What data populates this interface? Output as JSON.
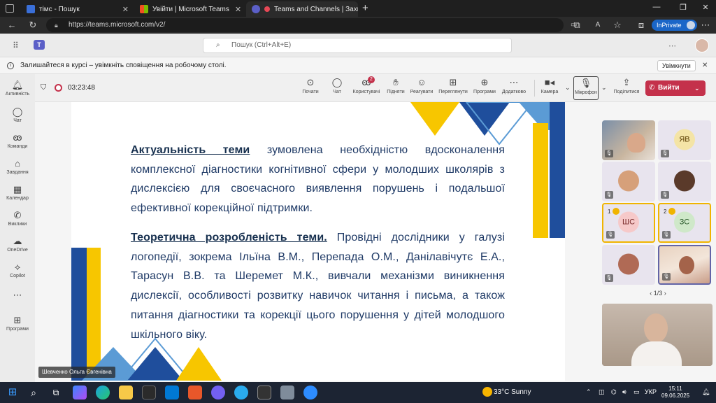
{
  "browser": {
    "tabs": [
      {
        "title": "тімс - Пошук",
        "favicon_color": "#3a6fd8"
      },
      {
        "title": "Увійти | Microsoft Teams",
        "favicon_color": "#f25022"
      },
      {
        "title": "Teams and Channels | Захис",
        "favicon_color": "#5b5fc7",
        "active": true
      }
    ],
    "new_tab_icon": "plus-icon",
    "url": "https://teams.microsoft.com/v2/",
    "inprivate_label": "InPrivate"
  },
  "teams_header": {
    "search_placeholder": "Пошук (Ctrl+Alt+E)"
  },
  "notification": {
    "text": "Залишайтеся в курсі – увімкніть сповіщення на робочому столі.",
    "button_label": "Увімкнути"
  },
  "rail": {
    "items": [
      {
        "label": "Активність",
        "icon": "bell-icon"
      },
      {
        "label": "Чат",
        "icon": "chat-icon"
      },
      {
        "label": "Команди",
        "icon": "teams-icon"
      },
      {
        "label": "Завдання",
        "icon": "tasks-icon"
      },
      {
        "label": "Календар",
        "icon": "calendar-icon"
      },
      {
        "label": "Виклики",
        "icon": "phone-icon"
      },
      {
        "label": "OneDrive",
        "icon": "cloud-icon"
      },
      {
        "label": "Copilot",
        "icon": "copilot-icon"
      },
      {
        "label": "Програми",
        "icon": "apps-icon"
      }
    ]
  },
  "meeting": {
    "timer": "03:23:48",
    "tools": [
      {
        "label": "Почати",
        "icon": "record-icon"
      },
      {
        "label": "Чат",
        "icon": "chat-icon"
      },
      {
        "label": "Користувачі",
        "icon": "people-icon",
        "badge": "2"
      },
      {
        "label": "Підняти",
        "icon": "hand-icon"
      },
      {
        "label": "Реагувати",
        "icon": "smile-icon"
      },
      {
        "label": "Переглянути",
        "icon": "view-icon"
      },
      {
        "label": "Програми",
        "icon": "apps-icon"
      },
      {
        "label": "Додатково",
        "icon": "more-icon"
      },
      {
        "label": "Камера",
        "icon": "camera-icon"
      },
      {
        "label": "Мікрофон",
        "icon": "mic-icon"
      },
      {
        "label": "Поділитися",
        "icon": "share-icon"
      }
    ],
    "leave_label": "Вийти"
  },
  "slide": {
    "para1_heading": "Актуальність теми",
    "para1_body": " зумовлена необхідністю вдосконалення комплексної діагностики когнітивної сфери у молодших школярів з дислексією для своєчасного виявлення порушень і подальшої ефективної корекційної підтримки.",
    "para2_heading": "Теоретична розробленість теми.",
    "para2_body": " Провідні дослідники у галузі логопедії, зокрема Ільїна В.М., Перепада О.М., Данілавічутє Е.А., Тарасун В.В. та Шеремет М.К., вивчали механізми виникнення дислексії, особливості розвитку навичок читання і письма, а також питання діагностики та корекції цього порушення у дітей молодшого шкільного віку.",
    "presenter_name": "Шевченко Ольга Євгенівна",
    "colors": {
      "blue": "#1f4e9c",
      "yellow": "#f7c600",
      "light_blue": "#5b9bd5"
    }
  },
  "participants": {
    "tiles": [
      {
        "initials": "",
        "kind": "video"
      },
      {
        "initials": "ЯВ",
        "kind": "initials",
        "color": "#f4e4a6"
      },
      {
        "initials": "",
        "kind": "avatar",
        "color": "#d6a07a"
      },
      {
        "initials": "",
        "kind": "avatar",
        "color": "#5a3a2a"
      },
      {
        "initials": "ШС",
        "kind": "initials",
        "color": "#f6c9c9",
        "raised_hand": "1"
      },
      {
        "initials": "ЗС",
        "kind": "initials",
        "color": "#cfe8c9",
        "raised_hand": "2"
      },
      {
        "initials": "",
        "kind": "avatar",
        "color": "#b06a55"
      },
      {
        "initials": "",
        "kind": "video"
      }
    ],
    "pager": "1/3"
  },
  "taskbar": {
    "weather": "33°C  Sunny",
    "language": "УКР",
    "time": "15:11",
    "date": "09.06.2025"
  }
}
